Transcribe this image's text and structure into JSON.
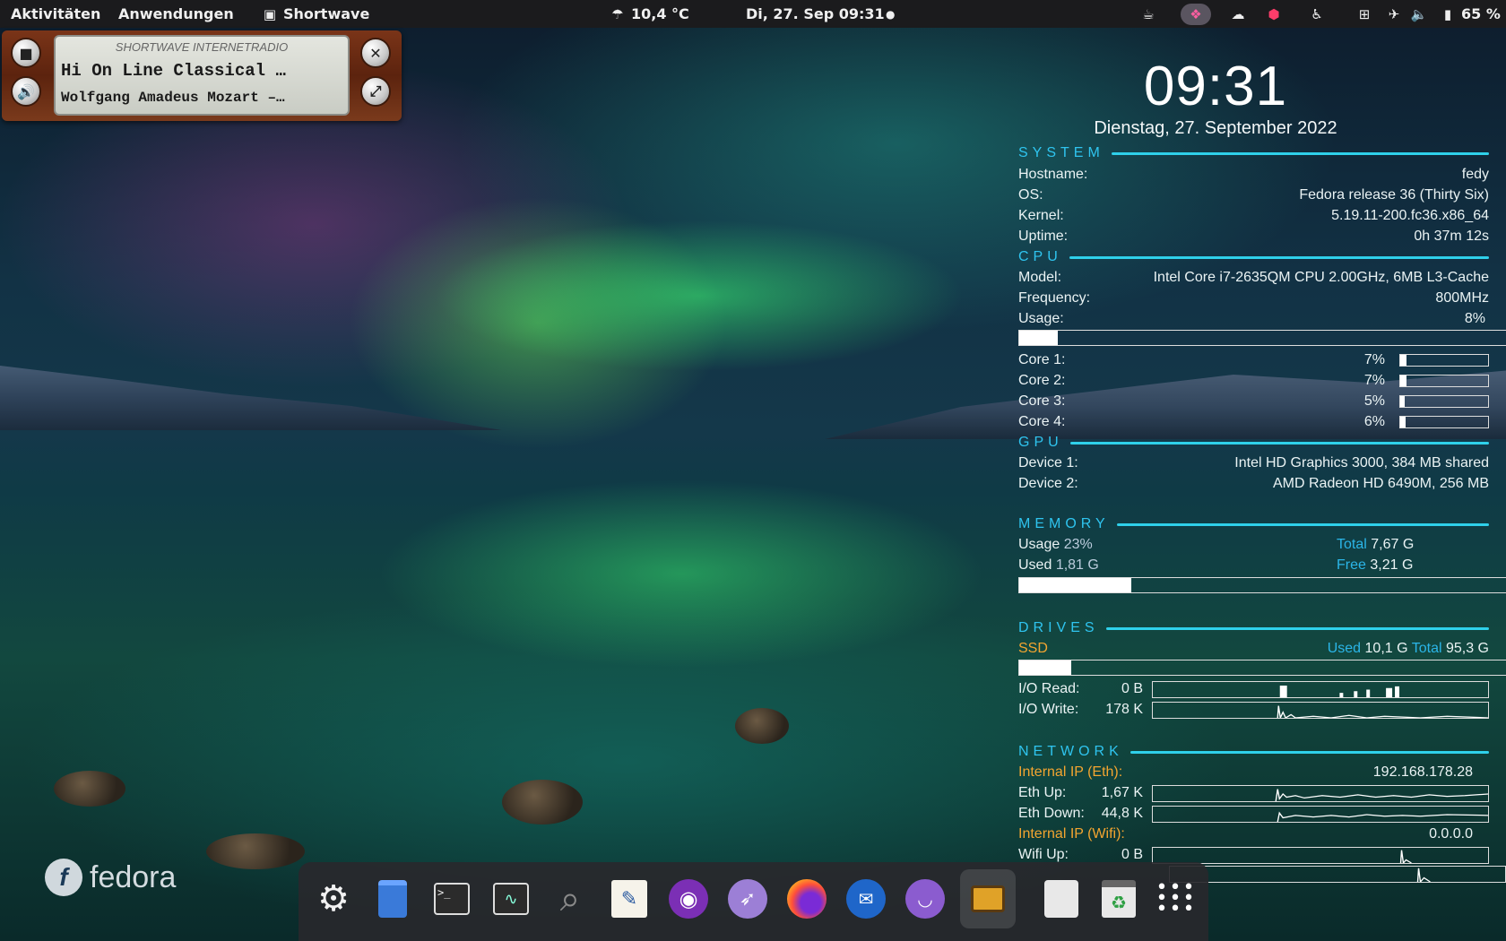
{
  "topbar": {
    "activities": "Aktivitäten",
    "applications": "Anwendungen",
    "app_menu": "Shortwave",
    "weather": "10,4 °C",
    "datetime": "Di, 27. Sep  09:31",
    "battery": "65 %"
  },
  "player": {
    "brand": "SHORTWAVE INTERNETRADIO",
    "station": "Hi On Line Classical …",
    "track": "Wolfgang Amadeus Mozart –…"
  },
  "conky": {
    "time": "09:31",
    "date": "Dienstag, 27. September 2022",
    "system": {
      "title": "SYSTEM",
      "hostname_label": "Hostname:",
      "hostname": "fedy",
      "os_label": "OS:",
      "os": "Fedora release 36 (Thirty Six)",
      "kernel_label": "Kernel:",
      "kernel": "5.19.11-200.fc36.x86_64",
      "uptime_label": "Uptime:",
      "uptime": "0h 37m 12s"
    },
    "cpu": {
      "title": "CPU",
      "model_label": "Model:",
      "model": "Intel Core i7-2635QM CPU 2.00GHz, 6MB L3-Cache",
      "freq_label": "Frequency:",
      "freq": "800MHz",
      "usage_label": "Usage:",
      "usage": "8%",
      "usage_value": 8,
      "cores": [
        {
          "label": "Core 1:",
          "value": "7%",
          "pct": 7
        },
        {
          "label": "Core 2:",
          "value": "7%",
          "pct": 7
        },
        {
          "label": "Core 3:",
          "value": "5%",
          "pct": 5
        },
        {
          "label": "Core 4:",
          "value": "6%",
          "pct": 6
        }
      ]
    },
    "gpu": {
      "title": "GPU",
      "d1_label": "Device 1:",
      "d1": "Intel HD Graphics 3000, 384 MB shared",
      "d2_label": "Device 2:",
      "d2": "AMD Radeon HD 6490M, 256 MB"
    },
    "memory": {
      "title": "MEMORY",
      "usage_label": "Usage",
      "usage": "23%",
      "usage_value": 23,
      "total_label": "Total",
      "total": "7,67 G",
      "used_label": "Used",
      "used": "1,81 G",
      "free_label": "Free",
      "free": "3,21 G"
    },
    "drives": {
      "title": "DRIVES",
      "name": "SSD",
      "used_label": "Used",
      "used": "10,1 G",
      "total_label": "Total",
      "total": "95,3 G",
      "usage_value": 10.6,
      "read_label": "I/O Read:",
      "read": "0 B",
      "write_label": "I/O Write:",
      "write": "178 K"
    },
    "network": {
      "title": "NETWORK",
      "eth_ip_label": "Internal IP (Eth):",
      "eth_ip": "192.168.178.28",
      "eth_up_label": "Eth Up:",
      "eth_up": "1,67 K",
      "eth_down_label": "Eth Down:",
      "eth_down": "44,8 K",
      "wifi_ip_label": "Internal IP (Wifi):",
      "wifi_ip": "0.0.0.0",
      "wifi_up_label": "Wifi Up:",
      "wifi_up": "0 B"
    }
  },
  "fedora_wordmark": "fedora",
  "dock": [
    {
      "name": "settings-icon",
      "glyph": "⚙"
    },
    {
      "name": "files-icon",
      "glyph": "▯"
    },
    {
      "name": "terminal-icon",
      "glyph": ">_"
    },
    {
      "name": "system-monitor-icon",
      "glyph": "∿"
    },
    {
      "name": "search-icon",
      "glyph": "🔍"
    },
    {
      "name": "text-editor-icon",
      "glyph": "✎"
    },
    {
      "name": "podcasts-icon",
      "glyph": "◉"
    },
    {
      "name": "eagle-icon",
      "glyph": "🦅"
    },
    {
      "name": "firefox-icon",
      "glyph": "🦊"
    },
    {
      "name": "thunderbird-icon",
      "glyph": "✉"
    },
    {
      "name": "mask-icon",
      "glyph": "◐"
    },
    {
      "name": "shortwave-icon",
      "glyph": "📻"
    },
    {
      "name": "disk-icon",
      "glyph": "◯"
    },
    {
      "name": "trash-icon",
      "glyph": "♻"
    },
    {
      "name": "app-grid-icon",
      "glyph": "⋮⋮⋮"
    }
  ]
}
